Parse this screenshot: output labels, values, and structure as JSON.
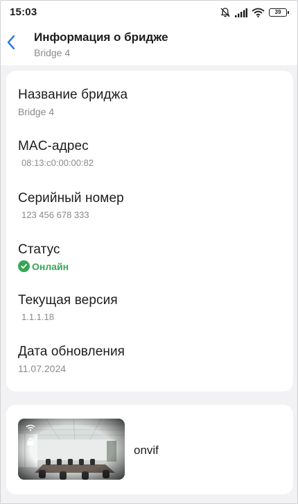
{
  "status_bar": {
    "time": "15:03",
    "battery": "39",
    "icons": [
      "bell-off-icon",
      "signal-icon",
      "wifi-icon",
      "battery-icon"
    ]
  },
  "header": {
    "title": "Информация о бридже",
    "subtitle": "Bridge 4",
    "back_icon": "chevron-left-icon"
  },
  "info": {
    "bridge_name": {
      "label": "Название бриджа",
      "value": "Bridge 4"
    },
    "mac": {
      "label": "MAC-адрес",
      "value": "08:13:c0:00:00:82"
    },
    "serial": {
      "label": "Серийный номер",
      "value": "123 456 678 333"
    },
    "status": {
      "label": "Статус",
      "value": "Онлайн"
    },
    "version": {
      "label": "Текущая версия",
      "value": "1.1.1.18"
    },
    "update_date": {
      "label": "Дата обновления",
      "value": "11.07.2024"
    }
  },
  "camera": {
    "name": "onvif"
  },
  "colors": {
    "accent": "#1a73e8",
    "online": "#34a853",
    "background": "#f2f2f4",
    "card": "#ffffff",
    "secondary_text": "#8a8a8e"
  }
}
